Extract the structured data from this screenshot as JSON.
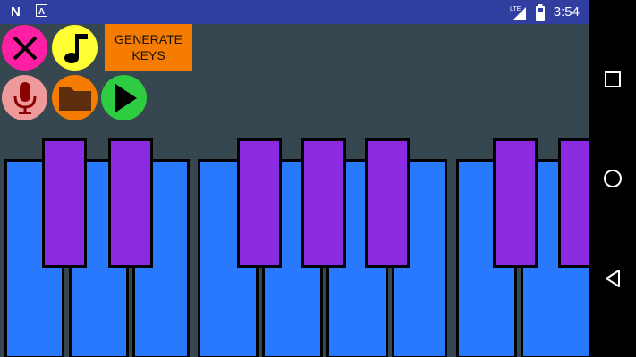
{
  "status_bar": {
    "time": "3:54",
    "network": "LTE",
    "left_icons": [
      "n-notification-icon",
      "a-notification-icon"
    ],
    "right_icons": [
      "lte-signal-icon",
      "battery-icon"
    ]
  },
  "toolbar": {
    "generate_keys_label": "GENERATE\nKEYS",
    "buttons": [
      {
        "name": "close-button",
        "icon": "x-icon",
        "color": "#ff1fa5"
      },
      {
        "name": "music-note-button",
        "icon": "music-note-icon",
        "color": "#ffff33"
      },
      {
        "name": "record-button",
        "icon": "microphone-icon",
        "color": "#ef9a9a"
      },
      {
        "name": "folder-button",
        "icon": "folder-icon",
        "color": "#f57c00"
      },
      {
        "name": "play-button",
        "icon": "play-icon",
        "color": "#2ecc40"
      }
    ]
  },
  "piano": {
    "white_key_color": "#2979ff",
    "black_key_color": "#8a2be2",
    "white_key_count": 9,
    "black_key_count": 7
  },
  "nav_bar": {
    "icons": [
      "recents-square-icon",
      "home-circle-icon",
      "back-triangle-icon"
    ]
  }
}
